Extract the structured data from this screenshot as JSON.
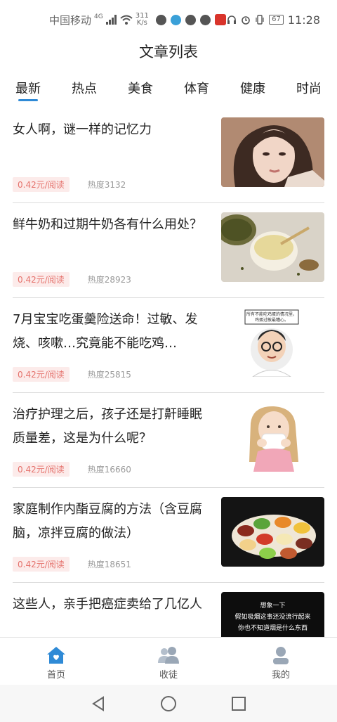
{
  "status_bar": {
    "carrier": "中国移动",
    "network": "4G",
    "speed_value": "311",
    "speed_unit": "K/s",
    "battery": "67",
    "time": "11:28"
  },
  "header": {
    "title": "文章列表"
  },
  "tabs": [
    {
      "label": "最新",
      "active": true
    },
    {
      "label": "热点",
      "active": false
    },
    {
      "label": "美食",
      "active": false
    },
    {
      "label": "体育",
      "active": false
    },
    {
      "label": "健康",
      "active": false
    },
    {
      "label": "时尚",
      "active": false
    }
  ],
  "articles": [
    {
      "title": "女人啊，谜一样的记忆力",
      "price": "0.42元/阅读",
      "heat": "热度3132",
      "thumb": "woman-portrait"
    },
    {
      "title": "鲜牛奶和过期牛奶各有什么用处？",
      "price": "0.42元/阅读",
      "heat": "热度28923",
      "thumb": "mung-bean-soup"
    },
    {
      "title": "7月宝宝吃蛋羹险送命！过敏、发烧、咳嗽…究竟能不能吃鸡…",
      "price": "0.42元/阅读",
      "heat": "热度25815",
      "thumb": "cartoon-doctor",
      "thumb_caption": "所有不能吃鸡蛋的情况里，鸡蛋过敏最糟心。"
    },
    {
      "title": "治疗护理之后，孩子还是打鼾睡眠质量差，这是为什么呢？",
      "price": "0.42元/阅读",
      "heat": "热度16660",
      "thumb": "girl-tissue"
    },
    {
      "title": "家庭制作内酯豆腐的方法（含豆腐脑，凉拌豆腐的做法）",
      "price": "0.42元/阅读",
      "heat": "热度18651",
      "thumb": "tofu-bowls"
    },
    {
      "title": "这些人，亲手把癌症卖给了几亿人",
      "price": "",
      "heat": "",
      "thumb": "dark-text-card",
      "thumb_lines": [
        "想象一下",
        "假如吸烟这事还没流行起来",
        "你也不知道烟是什么东西"
      ]
    }
  ],
  "bottom_nav": [
    {
      "label": "首页",
      "icon": "home-icon",
      "active": true
    },
    {
      "label": "收徒",
      "icon": "users-icon",
      "active": false
    },
    {
      "label": "我的",
      "icon": "profile-icon",
      "active": false
    }
  ],
  "colors": {
    "accent": "#2f8ad6",
    "price_text": "#e5726c",
    "price_bg": "#fcebea"
  }
}
